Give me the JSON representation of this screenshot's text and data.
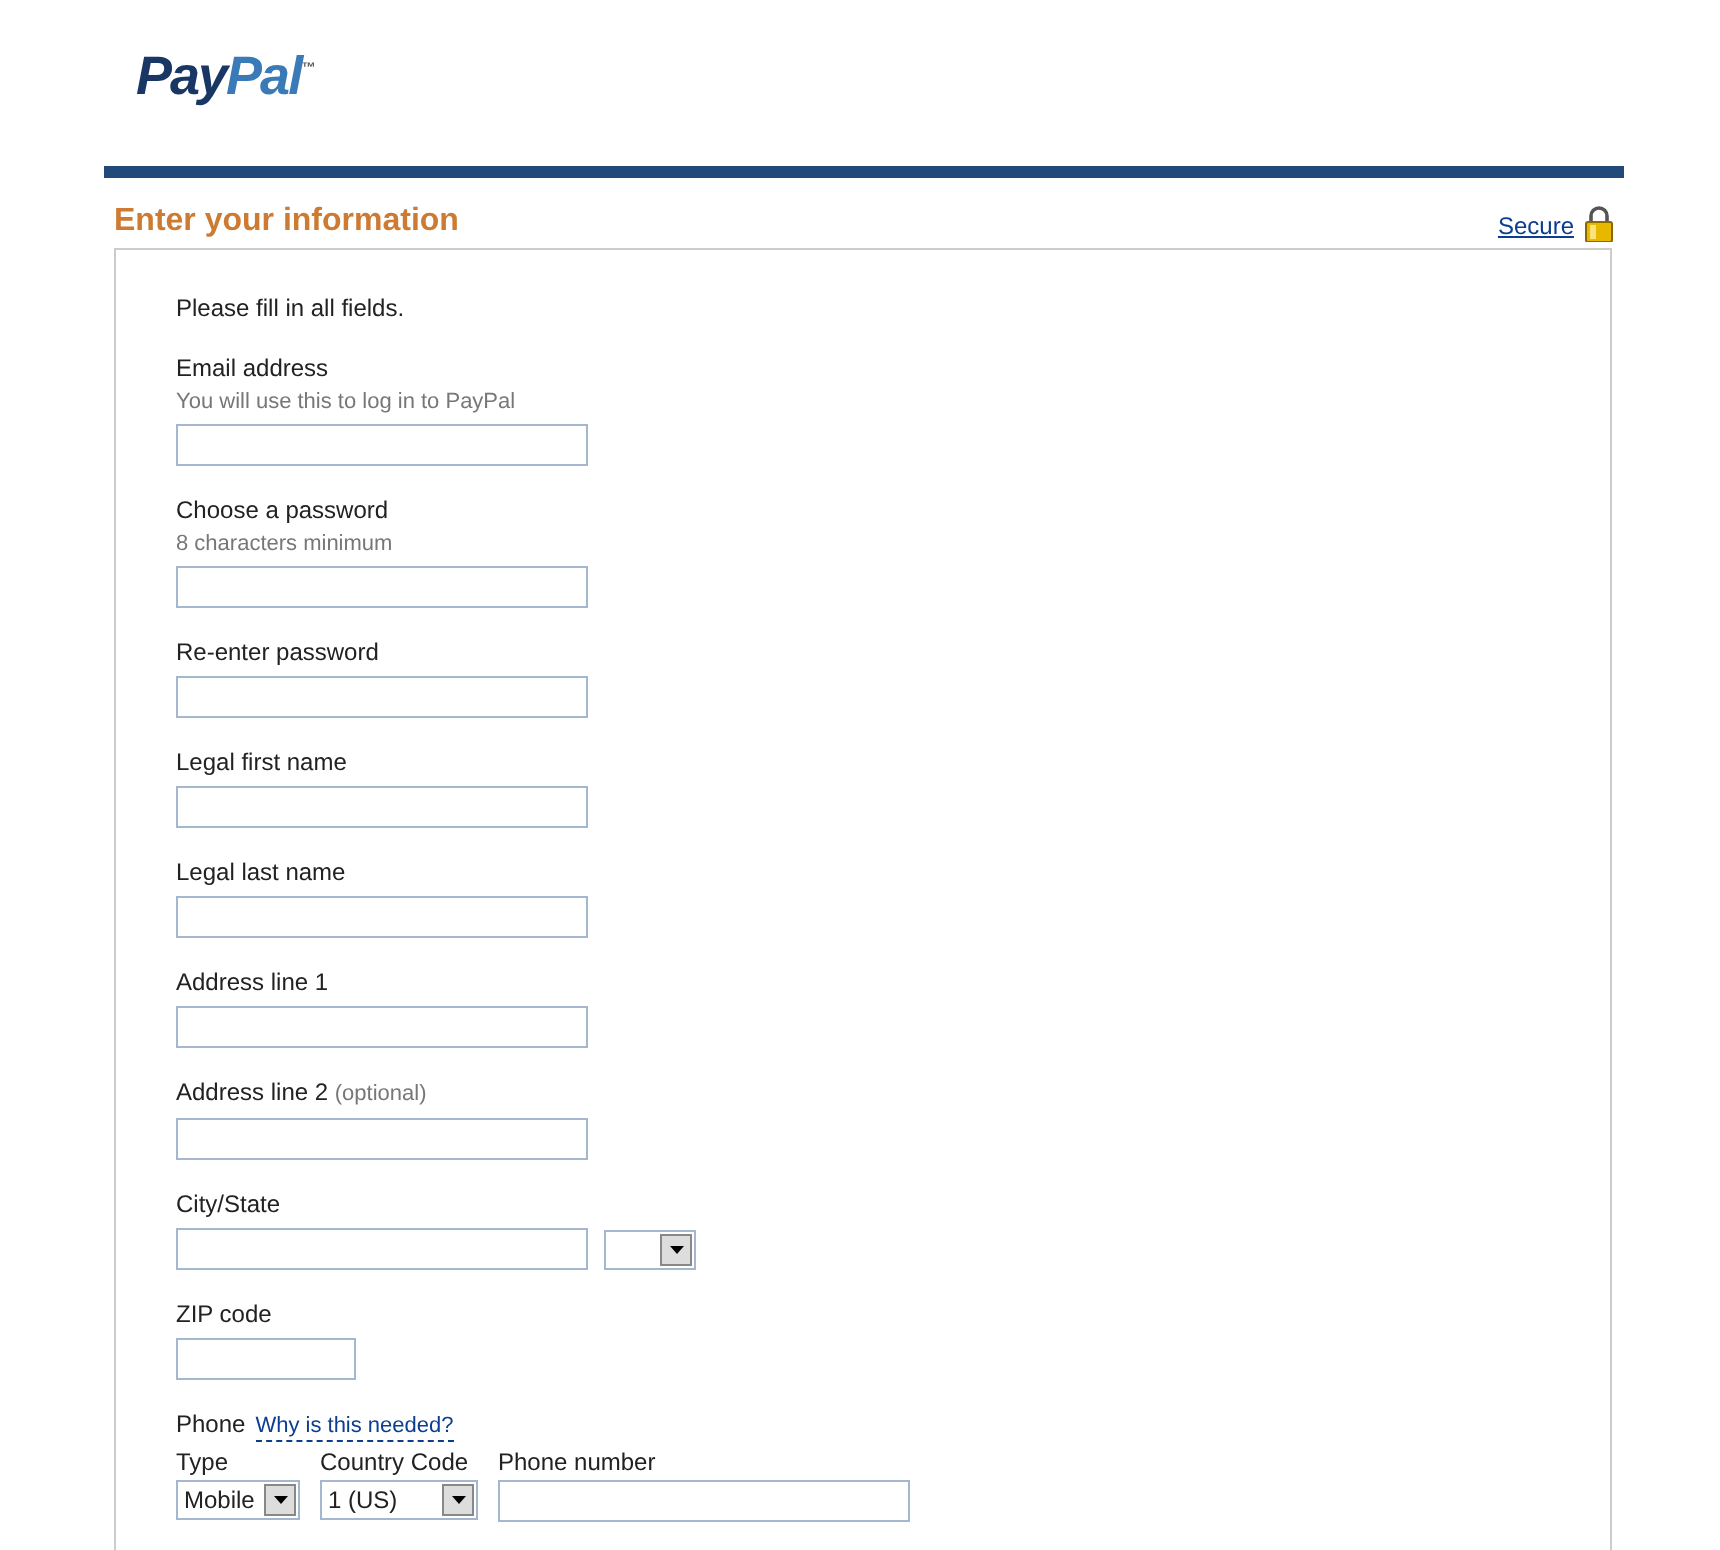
{
  "logo": {
    "parts": [
      "Pay",
      "Pal"
    ],
    "mark": "™"
  },
  "section": {
    "title": "Enter your information",
    "secure_link": "Secure"
  },
  "intro": "Please fill in all fields.",
  "fields": [
    {
      "kind": "text",
      "label": "Email address",
      "hint": "You will use this to log in to PayPal"
    },
    {
      "kind": "text",
      "label": "Choose a password",
      "hint": "8 characters minimum"
    },
    {
      "kind": "text",
      "label": "Re-enter password"
    },
    {
      "kind": "text",
      "label": "Legal first name"
    },
    {
      "kind": "text",
      "label": "Legal last name"
    },
    {
      "kind": "text",
      "label": "Address line 1"
    },
    {
      "kind": "text",
      "label": "Address line 2",
      "note": "(optional)"
    },
    {
      "kind": "city",
      "label": "City/State"
    },
    {
      "kind": "zip",
      "label": "ZIP code"
    }
  ],
  "phone": {
    "label": "Phone",
    "help_link": "Why is this needed?",
    "columns": [
      {
        "kind": "select",
        "label": "Type",
        "value": "Mobile"
      },
      {
        "kind": "select",
        "label": "Country Code",
        "value": "1 (US)"
      },
      {
        "kind": "input",
        "label": "Phone number"
      }
    ]
  }
}
